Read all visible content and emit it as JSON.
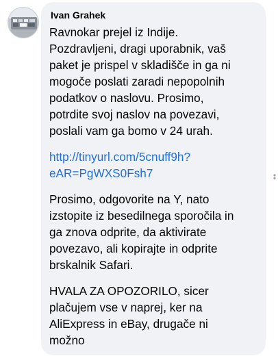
{
  "comment": {
    "author": "Ivan Grahek",
    "paragraphs": [
      {
        "lines": [
          "Ravnokar prejel iz Indije.",
          "Pozdravljeni, dragi uporabnik, vaš",
          "paket je prispel v skladišče in ga ni",
          "mogoče poslati zaradi nepopolnih",
          "podatkov o naslovu. Prosimo,",
          "potrdite svoj naslov na povezavi,",
          "poslali vam ga bomo v 24 urah."
        ]
      },
      {
        "link_lines": [
          "http://tinyurl.com/5cnuff9h?",
          "eAR=PgWXS0Fsh7"
        ]
      },
      {
        "lines": [
          "Prosimo, odgovorite na Y, nato",
          "izstopite iz besedilnega sporočila in",
          "ga znova odprite, da aktivirate",
          "povezavo, ali kopirajte in odprite",
          "brskalnik Safari."
        ]
      },
      {
        "lines": [
          "HVALA ZA OPOZORILO, sicer",
          "plačujem vse v naprej, ker na",
          "AliExpress in eBay, drugače ni",
          "možno"
        ]
      }
    ]
  },
  "colors": {
    "bubble_bg": "#f0f2f5",
    "text": "#050505",
    "link": "#216fdb"
  },
  "icons": {
    "avatar": "user-avatar-image",
    "side": "comment-options-icon"
  }
}
